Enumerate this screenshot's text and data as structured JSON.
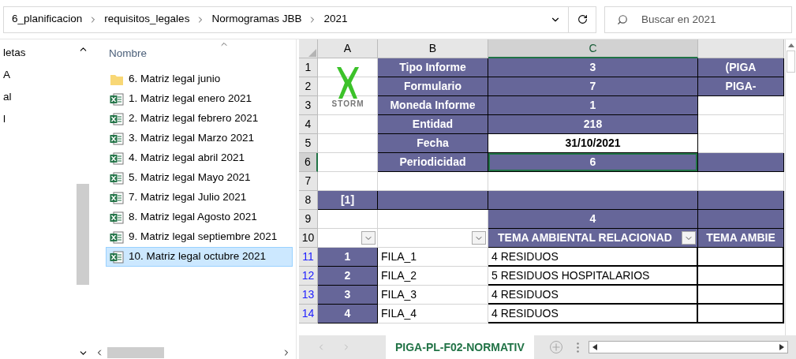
{
  "address_bar": {
    "crumbs": [
      "6_planificacion",
      "requisitos_legales",
      "Normogramas JBB",
      "2021"
    ]
  },
  "search": {
    "placeholder": "Buscar en 2021"
  },
  "nav_pane": {
    "items": [
      "letas",
      "A",
      "al",
      "l"
    ]
  },
  "file_list": {
    "column": "Nombre",
    "items": [
      {
        "kind": "folder",
        "name": "6. Matriz legal junio",
        "selected": false
      },
      {
        "kind": "excel",
        "name": "1. Matriz legal enero 2021",
        "selected": false
      },
      {
        "kind": "excel",
        "name": "2. Matriz legal febrero 2021",
        "selected": false
      },
      {
        "kind": "excel",
        "name": "3. Matriz legal Marzo 2021",
        "selected": false
      },
      {
        "kind": "excel",
        "name": "4. Matriz legal abril 2021",
        "selected": false
      },
      {
        "kind": "excel",
        "name": "5. Matriz legal Mayo 2021",
        "selected": false
      },
      {
        "kind": "excel",
        "name": "7. Matriz legal Julio 2021",
        "selected": false
      },
      {
        "kind": "excel",
        "name": "8. Matriz legal Agosto 2021",
        "selected": false
      },
      {
        "kind": "excel",
        "name": "9. Matriz legal septiembre 2021",
        "selected": false
      },
      {
        "kind": "excel",
        "name": "10. Matriz legal octubre 2021",
        "selected": true
      }
    ]
  },
  "sheet": {
    "logo": {
      "text": "STORM"
    },
    "columns": [
      {
        "label": "A",
        "selected": false
      },
      {
        "label": "B",
        "selected": false
      },
      {
        "label": "C",
        "selected": true
      },
      {
        "selected": false
      }
    ],
    "rows": [
      {
        "number": "1",
        "selected": false,
        "filtered": false,
        "cells": [
          {
            "kind": "blank"
          },
          {
            "kind": "band",
            "text": "Tipo Informe"
          },
          {
            "kind": "band",
            "text": "3"
          },
          {
            "kind": "band",
            "text": "(PIGA"
          }
        ]
      },
      {
        "number": "2",
        "selected": false,
        "filtered": false,
        "cells": [
          {
            "kind": "blank"
          },
          {
            "kind": "band",
            "text": "Formulario"
          },
          {
            "kind": "band",
            "text": "7"
          },
          {
            "kind": "band",
            "text": "PIGA-"
          }
        ]
      },
      {
        "number": "3",
        "selected": false,
        "filtered": false,
        "cells": [
          {
            "kind": "blank"
          },
          {
            "kind": "band",
            "text": "Moneda Informe"
          },
          {
            "kind": "band",
            "text": "1"
          },
          {
            "kind": "blank"
          }
        ]
      },
      {
        "number": "4",
        "selected": false,
        "filtered": false,
        "cells": [
          {
            "kind": "blank"
          },
          {
            "kind": "band",
            "text": "Entidad"
          },
          {
            "kind": "band",
            "text": "218"
          },
          {
            "kind": "blank"
          }
        ]
      },
      {
        "number": "5",
        "selected": false,
        "filtered": false,
        "cells": [
          {
            "kind": "blank"
          },
          {
            "kind": "band",
            "text": "Fecha"
          },
          {
            "kind": "value",
            "text": "31/10/2021"
          },
          {
            "kind": "blank"
          }
        ]
      },
      {
        "number": "6",
        "selected": true,
        "filtered": false,
        "cells": [
          {
            "kind": "blank"
          },
          {
            "kind": "band",
            "text": "Periodicidad"
          },
          {
            "kind": "band",
            "text": "6"
          },
          {
            "kind": "band"
          }
        ]
      },
      {
        "number": "7",
        "selected": false,
        "filtered": false,
        "cells": [
          {
            "kind": "blank"
          },
          {
            "kind": "blank"
          },
          {
            "kind": "blank"
          },
          {
            "kind": "blank"
          }
        ]
      },
      {
        "number": "8",
        "selected": false,
        "filtered": false,
        "cells": [
          {
            "kind": "band",
            "text": "[1]"
          },
          {
            "kind": "band"
          },
          {
            "kind": "band"
          },
          {
            "kind": "band"
          }
        ]
      },
      {
        "number": "9",
        "selected": false,
        "filtered": false,
        "cells": [
          {
            "kind": "blank"
          },
          {
            "kind": "blank"
          },
          {
            "kind": "band",
            "text": "4"
          },
          {
            "kind": "band"
          }
        ]
      },
      {
        "number": "10",
        "selected": false,
        "filtered": false,
        "cells": [
          {
            "kind": "blank",
            "filter": true
          },
          {
            "kind": "blank",
            "filter": true
          },
          {
            "kind": "band",
            "text": "TEMA AMBIENTAL RELACIONAD",
            "filter": true
          },
          {
            "kind": "band",
            "text": "TEMA AMBIE"
          }
        ]
      },
      {
        "number": "11",
        "selected": false,
        "filtered": true,
        "cells": [
          {
            "kind": "band",
            "text": "1"
          },
          {
            "kind": "text",
            "text": "FILA_1"
          },
          {
            "kind": "boxed",
            "text": "4 RESIDUOS"
          },
          {
            "kind": "boxed"
          }
        ]
      },
      {
        "number": "12",
        "selected": false,
        "filtered": true,
        "cells": [
          {
            "kind": "band",
            "text": "2"
          },
          {
            "kind": "text",
            "text": "FILA_2"
          },
          {
            "kind": "boxed",
            "text": "5 RESIDUOS HOSPITALARIOS"
          },
          {
            "kind": "boxed"
          }
        ]
      },
      {
        "number": "13",
        "selected": false,
        "filtered": true,
        "cells": [
          {
            "kind": "band",
            "text": "3"
          },
          {
            "kind": "text",
            "text": "FILA_3"
          },
          {
            "kind": "boxed",
            "text": "4 RESIDUOS"
          },
          {
            "kind": "boxed"
          }
        ]
      },
      {
        "number": "14",
        "selected": false,
        "filtered": true,
        "cells": [
          {
            "kind": "band",
            "text": "4"
          },
          {
            "kind": "text",
            "text": "FILA_4"
          },
          {
            "kind": "boxed",
            "text": "4 RESIDUOS"
          },
          {
            "kind": "boxed"
          }
        ]
      }
    ],
    "tabs": [
      {
        "label": "PIGA-PL-F02-NORMATIV",
        "selected": true
      }
    ]
  }
}
